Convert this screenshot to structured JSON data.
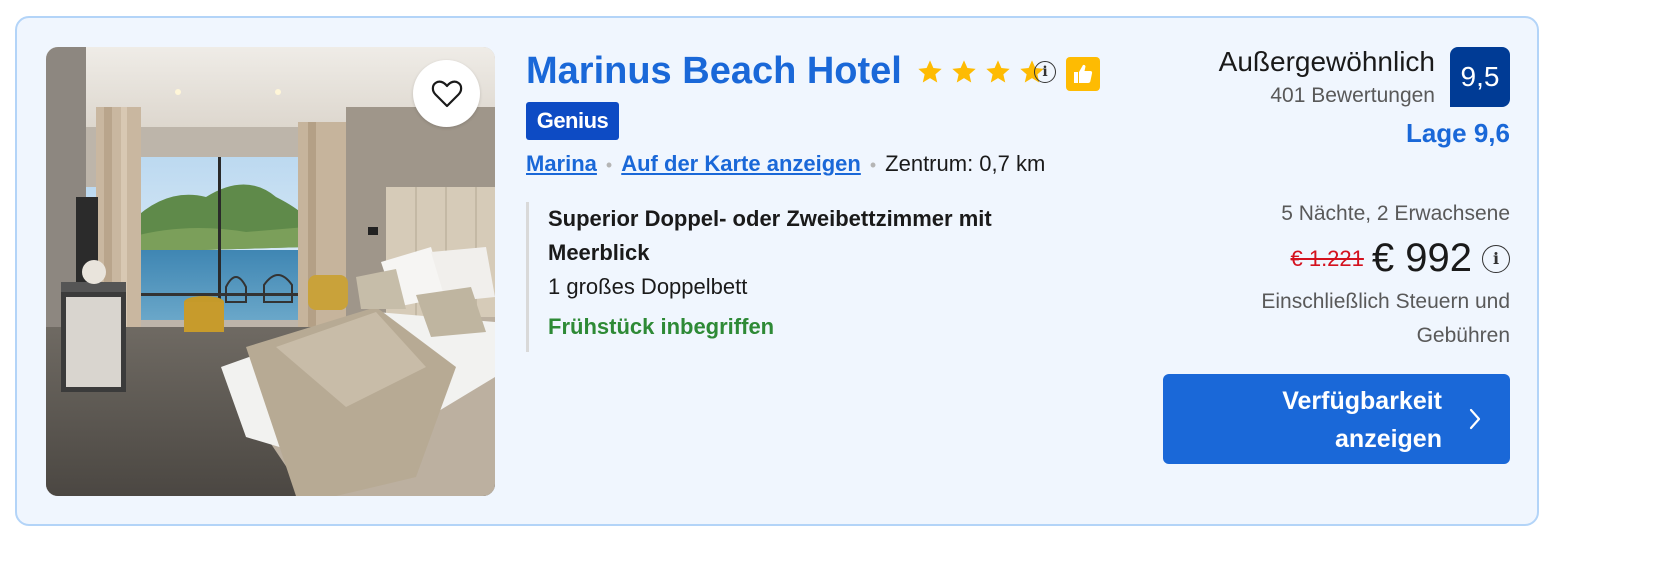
{
  "hotel": {
    "name": "Marinus Beach Hotel",
    "star_count": 4,
    "star_color": "#febb02",
    "info_glyph": "i",
    "thumb_icon": "thumbs-up-icon",
    "genius_label": "Genius",
    "photo_alt": "Hotel room with sea view"
  },
  "location": {
    "area_link": "Marina",
    "map_link": "Auf der Karte anzeigen",
    "center_distance": "Zentrum: 0,7 km"
  },
  "room": {
    "title_line1": "Superior Doppel- oder Zweibettzimmer mit",
    "title_line2": "Meerblick",
    "bed": "1 großes Doppelbett",
    "breakfast": "Frühstück inbegriffen"
  },
  "rating": {
    "word": "Außergewöhnlich",
    "reviews": "401 Bewertungen",
    "score": "9,5",
    "location_score": "Lage 9,6"
  },
  "price": {
    "nights_guests": "5 Nächte, 2 Erwachsene",
    "old": "€ 1.221",
    "current": "€ 992",
    "info_glyph": "i",
    "taxes_line1": "Einschließlich Steuern und",
    "taxes_line2": "Gebühren"
  },
  "cta": {
    "line1": "Verfügbarkeit",
    "line2": "anzeigen"
  },
  "colors": {
    "link": "#1a68d8",
    "score_bg": "#003b95",
    "genius_bg": "#0d4bc4",
    "breakfast": "#2e8a36",
    "old_price": "#d4111e",
    "card_bg": "#f0f6fe",
    "card_border": "#b3d4f8"
  }
}
